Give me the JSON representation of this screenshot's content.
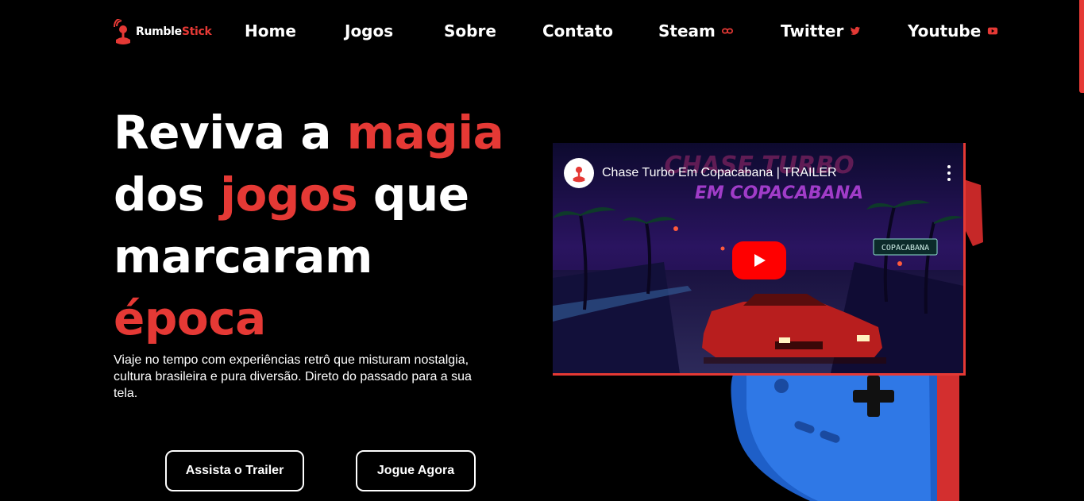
{
  "brand": {
    "part1": "Rumble",
    "part2": "Stick",
    "accent": "#e53935"
  },
  "nav": {
    "items": [
      {
        "label": "Home",
        "icon": ""
      },
      {
        "label": "Jogos",
        "icon": ""
      },
      {
        "label": "Sobre",
        "icon": ""
      },
      {
        "label": "Contato",
        "icon": ""
      },
      {
        "label": "Steam",
        "icon": "link-icon"
      },
      {
        "label": "Twitter",
        "icon": "twitter-icon"
      },
      {
        "label": "Youtube",
        "icon": "youtube-icon"
      }
    ]
  },
  "hero": {
    "line1_white": "Reviva a ",
    "line1_red": "magia",
    "line2_white_a": "dos ",
    "line2_red": "jogos",
    "line2_white_b": " que",
    "line3_white": "marcaram",
    "line4_red": "época",
    "subtitle": "Viaje no tempo com experiências retrô que misturam nostalgia, cultura brasileira e pura diversão. Direto do passado para a sua tela.",
    "buttons": {
      "trailer": "Assista o Trailer",
      "play": "Jogue Agora"
    }
  },
  "video": {
    "title": "Chase Turbo Em Copacabana | TRAILER",
    "scene_title_line1": "CHASE TURBO",
    "scene_title_line2": "EM COPACABANA",
    "sign_text": "COPACABANA"
  }
}
